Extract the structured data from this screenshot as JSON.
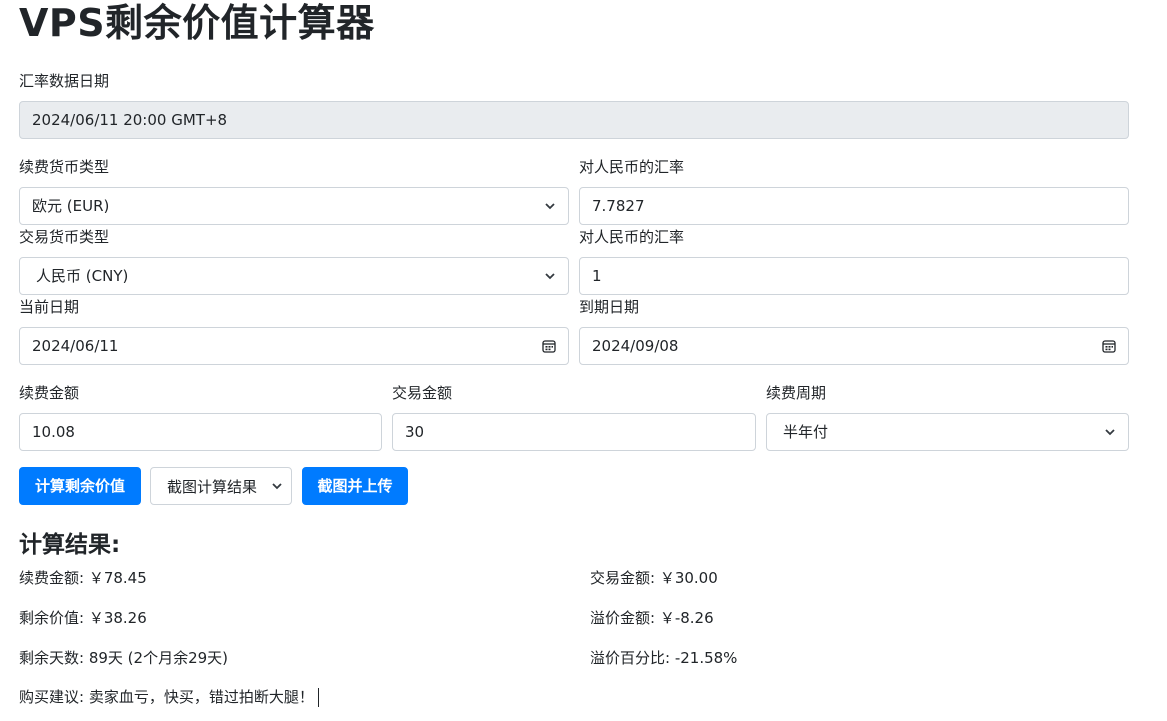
{
  "title": "VPS剩余价值计算器",
  "rate_date": {
    "label": "汇率数据日期",
    "value": "2024/06/11 20:00 GMT+8"
  },
  "renew_currency": {
    "label": "续费货币类型",
    "value": "欧元 (EUR)",
    "rate_label": "对人民币的汇率",
    "rate_value": "7.7827"
  },
  "trade_currency": {
    "label": "交易货币类型",
    "value": "人民币 (CNY)",
    "rate_label": "对人民币的汇率",
    "rate_value": "1"
  },
  "dates": {
    "current_label": "当前日期",
    "current_value": "2024/06/11",
    "expiry_label": "到期日期",
    "expiry_value": "2024/09/08"
  },
  "amounts": {
    "renew_label": "续费金额",
    "renew_value": "10.08",
    "trade_label": "交易金额",
    "trade_value": "30",
    "cycle_label": "续费周期",
    "cycle_value": "半年付"
  },
  "actions": {
    "calculate": "计算剩余价值",
    "screenshot_select": "截图计算结果",
    "screenshot_upload": "截图并上传"
  },
  "results": {
    "heading": "计算结果:",
    "renew_amount": "续费金额: ￥78.45",
    "trade_amount": "交易金额: ￥30.00",
    "remaining_value": "剩余价值: ￥38.26",
    "premium_amount": "溢价金额: ￥-8.26",
    "remaining_days": "剩余天数: 89天 (2个月余29天)",
    "premium_percent": "溢价百分比: -21.58%",
    "advice": "购买建议: 卖家血亏，快买，错过拍断大腿！"
  },
  "colors": {
    "primary": "#007bff",
    "readonly_bg": "#e9ecef",
    "border": "#ced4da"
  }
}
